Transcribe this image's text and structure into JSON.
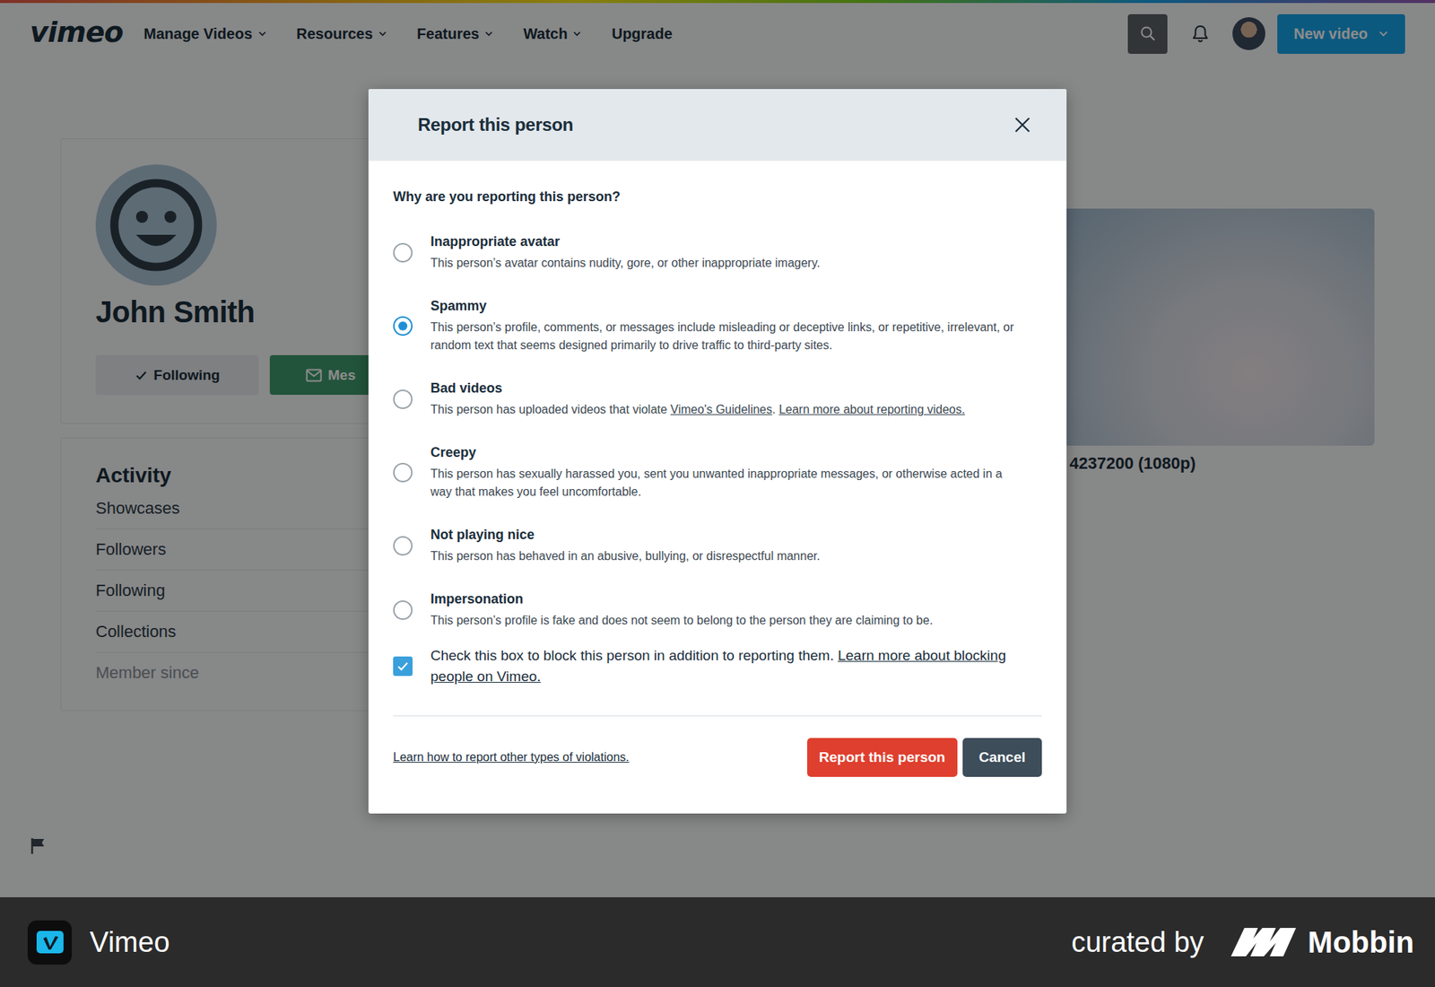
{
  "nav": {
    "logo": "vimeo",
    "items": [
      {
        "label": "Manage Videos",
        "dropdown": true
      },
      {
        "label": "Resources",
        "dropdown": true
      },
      {
        "label": "Features",
        "dropdown": true
      },
      {
        "label": "Watch",
        "dropdown": true
      },
      {
        "label": "Upgrade",
        "dropdown": false
      }
    ],
    "new_video": {
      "label": "New video",
      "dropdown": true
    }
  },
  "profile": {
    "name": "John Smith",
    "follow_button": {
      "label": "Following",
      "checked": true
    },
    "message_button": {
      "label": "Mes"
    }
  },
  "activity": {
    "title": "Activity",
    "items": [
      {
        "label": "Showcases",
        "muted": false
      },
      {
        "label": "Followers",
        "muted": false
      },
      {
        "label": "Following",
        "muted": false
      },
      {
        "label": "Collections",
        "muted": false
      },
      {
        "label": "Member since",
        "muted": true
      }
    ]
  },
  "video": {
    "title": "4237200 (1080p)"
  },
  "modal": {
    "title": "Report this person",
    "question": "Why are you reporting this person?",
    "options": [
      {
        "title": "Inappropriate avatar",
        "selected": false,
        "description": [
          {
            "text": "This person’s avatar contains nudity, gore, or other inappropriate imagery.",
            "link": false
          }
        ]
      },
      {
        "title": "Spammy",
        "selected": true,
        "description": [
          {
            "text": "This person’s profile, comments, or messages include misleading or deceptive links, or repetitive, irrelevant, or random text that seems designed primarily to drive traffic to third-party sites.",
            "link": false
          }
        ]
      },
      {
        "title": "Bad videos",
        "selected": false,
        "description": [
          {
            "text": "This person has uploaded videos that violate ",
            "link": false
          },
          {
            "text": "Vimeo's Guidelines",
            "link": true
          },
          {
            "text": ". ",
            "link": false
          },
          {
            "text": "Learn more about reporting videos.",
            "link": true
          }
        ]
      },
      {
        "title": "Creepy",
        "selected": false,
        "description": [
          {
            "text": "This person has sexually harassed you, sent you unwanted inappropriate messages, or otherwise acted in a way that makes you feel uncomfortable.",
            "link": false
          }
        ]
      },
      {
        "title": "Not playing nice",
        "selected": false,
        "description": [
          {
            "text": "This person has behaved in an abusive, bullying, or disrespectful manner.",
            "link": false
          }
        ]
      },
      {
        "title": "Impersonation",
        "selected": false,
        "description": [
          {
            "text": "This person’s profile is fake and does not seem to belong to the person they are claiming to be.",
            "link": false
          }
        ]
      }
    ],
    "block": {
      "checked": true,
      "text": "Check this box to block this person in addition to reporting them.",
      "link": "Learn more about blocking people on Vimeo."
    },
    "footer_link": "Learn how to report other types of violations.",
    "buttons": [
      {
        "label": "Report this person",
        "kind": "primary"
      },
      {
        "label": "Cancel",
        "kind": "secondary"
      }
    ]
  },
  "attribution": {
    "app": "Vimeo",
    "curated_by": "curated by",
    "brand": "Mobbin"
  }
}
